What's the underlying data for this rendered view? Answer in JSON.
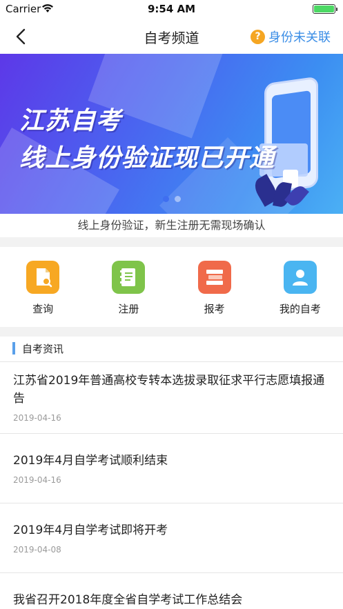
{
  "status_bar": {
    "carrier": "Carrier",
    "time": "9:54 AM",
    "wifi_icon": "wifi-icon",
    "battery_icon": "battery-icon"
  },
  "nav": {
    "title": "自考频道",
    "back_icon": "chevron-left-icon",
    "identity_icon": "question-circle-icon",
    "identity_icon_glyph": "?",
    "identity_label": "身份未关联"
  },
  "banner": {
    "line1": "江苏自考",
    "line2": "线上身份验证现已开通",
    "slide_count": 2,
    "active_slide": 1
  },
  "caption": "线上身份验证，新生注册无需现场确认",
  "actions": [
    {
      "label": "查询",
      "icon": "search-document-icon",
      "color": "#f7a823"
    },
    {
      "label": "注册",
      "icon": "notebook-icon",
      "color": "#7fc44a"
    },
    {
      "label": "报考",
      "icon": "books-icon",
      "color": "#f06a4a"
    },
    {
      "label": "我的自考",
      "icon": "user-icon",
      "color": "#4ab5f1"
    }
  ],
  "news": {
    "section_title": "自考资讯",
    "items": [
      {
        "headline": "江苏省2019年普通高校专转本选拔录取征求平行志愿填报通告",
        "date": "2019-04-16"
      },
      {
        "headline": "2019年4月自学考试顺利结束",
        "date": "2019-04-16"
      },
      {
        "headline": "2019年4月自学考试即将开考",
        "date": "2019-04-08"
      },
      {
        "headline": "我省召开2018年度全省自学考试工作总结会",
        "date": ""
      }
    ]
  },
  "colors": {
    "accent_blue": "#3a8de6",
    "section_bar": "#5aa0ea",
    "warning_orange": "#f5a623"
  }
}
